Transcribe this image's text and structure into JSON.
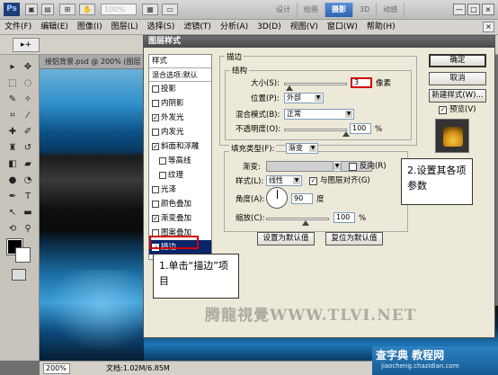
{
  "app": {
    "logo": "Ps",
    "zoom_display": "100%",
    "workspaces": [
      "设计",
      "绘画",
      "摄影",
      "3D",
      "动感"
    ],
    "active_workspace": "摄影",
    "window_buttons": [
      "—",
      "□",
      "×"
    ]
  },
  "menu": {
    "items": [
      "文件(F)",
      "编辑(E)",
      "图像(I)",
      "图层(L)",
      "选择(S)",
      "滤镜(T)",
      "分析(A)",
      "3D(D)",
      "视图(V)",
      "窗口(W)",
      "帮助(H)"
    ],
    "close": "×"
  },
  "document": {
    "tab_title": "接铝背景.psd @ 200% (图层",
    "zoom": "200%",
    "doc_info": "文档:1.02M/6.85M"
  },
  "dialog": {
    "title": "图层样式",
    "styles_header": "样式",
    "blend_options": "混合选项:默认",
    "style_items": [
      {
        "label": "投影",
        "checked": false,
        "indent": false
      },
      {
        "label": "内阴影",
        "checked": false,
        "indent": false
      },
      {
        "label": "外发光",
        "checked": true,
        "indent": false
      },
      {
        "label": "内发光",
        "checked": false,
        "indent": false
      },
      {
        "label": "斜面和浮雕",
        "checked": true,
        "indent": false
      },
      {
        "label": "等高线",
        "checked": false,
        "indent": true
      },
      {
        "label": "纹理",
        "checked": false,
        "indent": true
      },
      {
        "label": "光泽",
        "checked": false,
        "indent": false
      },
      {
        "label": "颜色叠加",
        "checked": false,
        "indent": false
      },
      {
        "label": "渐变叠加",
        "checked": true,
        "indent": false
      },
      {
        "label": "图案叠加",
        "checked": false,
        "indent": false
      },
      {
        "label": "描边",
        "checked": true,
        "indent": false,
        "selected": true
      }
    ],
    "stroke": {
      "group_title": "描边",
      "structure_title": "结构",
      "size_label": "大小(S):",
      "size_value": "3",
      "size_unit": "像素",
      "position_label": "位置(P):",
      "position_value": "外部",
      "blend_label": "混合模式(B):",
      "blend_value": "正常",
      "opacity_label": "不透明度(O):",
      "opacity_value": "100",
      "opacity_unit": "%"
    },
    "fill": {
      "fill_type_label": "填充类型(F):",
      "fill_type_value": "渐变",
      "gradient_label": "渐变:",
      "reverse_label": "反向(R)",
      "style_label": "样式(L):",
      "style_value": "线性",
      "align_label": "与图层对齐(G)",
      "angle_label": "角度(A):",
      "angle_value": "90",
      "angle_unit": "度",
      "scale_label": "缩放(C):",
      "scale_value": "100",
      "scale_unit": "%"
    },
    "buttons": {
      "make_default": "设置为默认值",
      "reset_default": "复位为默认值",
      "ok": "确定",
      "cancel": "取消",
      "new_style": "新建样式(W)...",
      "preview": "预览(V)"
    }
  },
  "callouts": {
    "step1": "1.单击“描边”项目",
    "step2": "2.设置其各项参数"
  },
  "watermark": {
    "text": "腾龍視覺WWW.TLVI.NET",
    "footer_main": "查字典 教程网",
    "footer_sub": "jiaocheng.chazidian.com"
  }
}
